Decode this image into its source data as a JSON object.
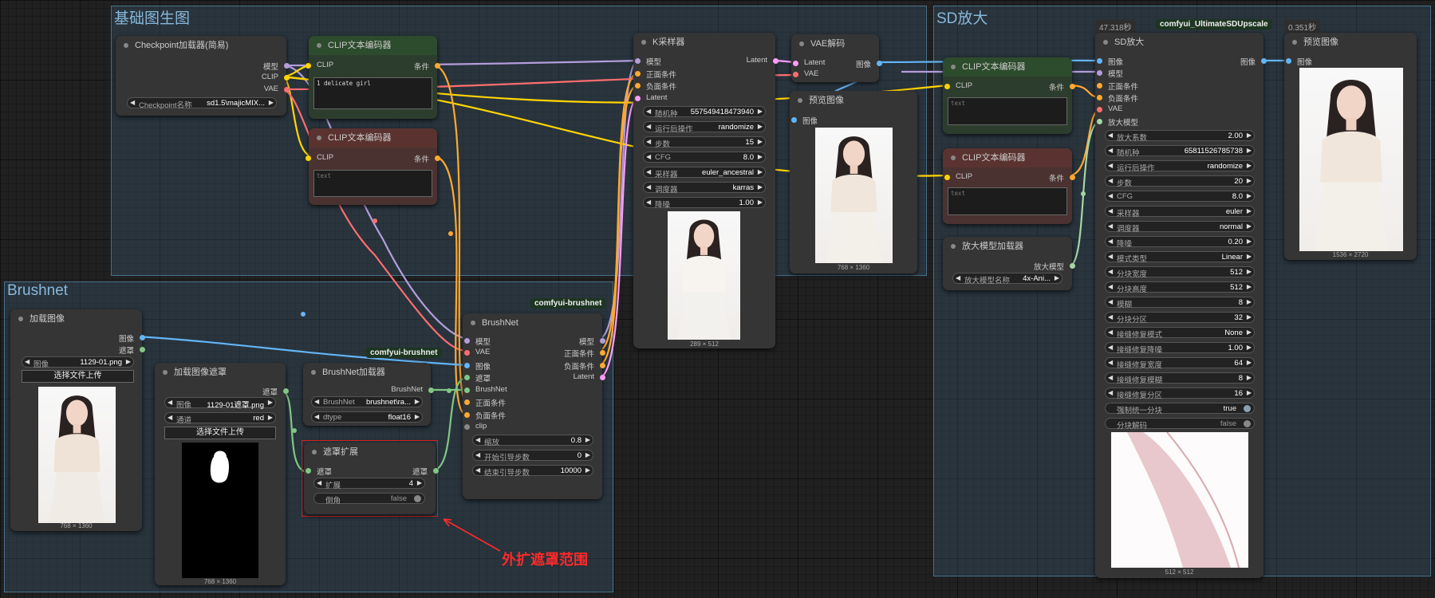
{
  "groups": {
    "base": "基础图生图",
    "brushnet": "Brushnet",
    "upscale": "SD放大"
  },
  "ckpt": {
    "title": "Checkpoint加载器(简易)",
    "out_model": "模型",
    "out_clip": "CLIP",
    "out_vae": "VAE",
    "ckpt_label": "Checkpoint名称",
    "ckpt_value": "sd1.5\\majicMIX..."
  },
  "clip_pos": {
    "title": "CLIP文本编码器",
    "in_clip": "CLIP",
    "out": "条件",
    "text": "1 delicate girl"
  },
  "clip_neg": {
    "title": "CLIP文本编码器",
    "in_clip": "CLIP",
    "out": "条件",
    "text": "text"
  },
  "ksampler": {
    "title": "K采样器",
    "in_model": "模型",
    "in_pos": "正面条件",
    "in_neg": "负面条件",
    "in_latent": "Latent",
    "out_latent": "Latent",
    "widgets": [
      {
        "label": "随机种",
        "value": "557549418473940"
      },
      {
        "label": "运行后操作",
        "value": "randomize"
      },
      {
        "label": "步数",
        "value": "15"
      },
      {
        "label": "CFG",
        "value": "8.0"
      },
      {
        "label": "采样器",
        "value": "euler_ancestral"
      },
      {
        "label": "调度器",
        "value": "karras"
      },
      {
        "label": "降噪",
        "value": "1.00"
      }
    ],
    "size": "289 × 512"
  },
  "vae_decode": {
    "title": "VAE解码",
    "in_latent": "Latent",
    "in_vae": "VAE",
    "out_image": "图像"
  },
  "preview1": {
    "title": "预览图像",
    "in_image": "图像",
    "size": "768 × 1360"
  },
  "load_image": {
    "title": "加载图像",
    "out_image": "图像",
    "out_mask": "遮罩",
    "img_label": "图像",
    "img_value": "1129-01.png",
    "upload": "选择文件上传",
    "size": "768 × 1360"
  },
  "load_mask": {
    "title": "加载图像遮罩",
    "out_mask": "遮罩",
    "img_label": "图像",
    "img_value": "1129-01遮罩.png",
    "ch_label": "通道",
    "ch_value": "red",
    "upload": "选择文件上传",
    "size": "768 × 1360"
  },
  "bn_loader": {
    "title": "BrushNet加载器",
    "badge": "comfyui-brushnet",
    "out": "BrushNet",
    "bn_label": "BrushNet",
    "bn_value": "brushnet\\ra...",
    "dt_label": "dtype",
    "dt_value": "float16"
  },
  "mask_expand": {
    "title": "遮罩扩展",
    "in_mask": "遮罩",
    "out_mask": "遮罩",
    "exp_label": "扩展",
    "exp_value": "4",
    "tap_label": "倒角",
    "tap_value": "false"
  },
  "brushnet": {
    "title": "BrushNet",
    "badge": "comfyui-brushnet",
    "in_model": "模型",
    "in_vae": "VAE",
    "in_image": "图像",
    "in_mask": "遮罩",
    "in_bn": "BrushNet",
    "in_pos": "正面条件",
    "in_neg": "负面条件",
    "in_clip": "clip",
    "out_model": "模型",
    "out_pos": "正面条件",
    "out_neg": "负面条件",
    "out_latent": "Latent",
    "w_scale_label": "缩放",
    "w_scale_value": "0.8",
    "w_start_label": "开始引导步数",
    "w_start_value": "0",
    "w_end_label": "结束引导步数",
    "w_end_value": "10000"
  },
  "annotation": "外扩遮罩范围",
  "up_clip_pos": {
    "title": "CLIP文本编码器",
    "in_clip": "CLIP",
    "out": "条件",
    "text": "text"
  },
  "up_clip_neg": {
    "title": "CLIP文本编码器",
    "in_clip": "CLIP",
    "out": "条件",
    "text": "text"
  },
  "up_model_loader": {
    "title": "放大模型加载器",
    "out": "放大模型",
    "label": "放大模型名称",
    "value": "4x-Ani..."
  },
  "sd_upscale": {
    "title": "SD放大",
    "badge": "comfyui_UltimateSDUpscale",
    "time": "47.318秒",
    "in_image": "图像",
    "in_model": "模型",
    "in_pos": "正面条件",
    "in_neg": "负面条件",
    "in_vae": "VAE",
    "in_up": "放大模型",
    "out_image": "图像",
    "widgets": [
      {
        "label": "放大系数",
        "value": "2.00"
      },
      {
        "label": "随机种",
        "value": "65811526785738"
      },
      {
        "label": "运行后操作",
        "value": "randomize"
      },
      {
        "label": "步数",
        "value": "20"
      },
      {
        "label": "CFG",
        "value": "8.0"
      },
      {
        "label": "采样器",
        "value": "euler"
      },
      {
        "label": "调度器",
        "value": "normal"
      },
      {
        "label": "降噪",
        "value": "0.20"
      },
      {
        "label": "模式类型",
        "value": "Linear"
      },
      {
        "label": "分块宽度",
        "value": "512"
      },
      {
        "label": "分块高度",
        "value": "512"
      },
      {
        "label": "模糊",
        "value": "8"
      },
      {
        "label": "分块分区",
        "value": "32"
      },
      {
        "label": "接缝修复模式",
        "value": "None"
      },
      {
        "label": "接缝修复降噪",
        "value": "1.00"
      },
      {
        "label": "接缝修复宽度",
        "value": "64"
      },
      {
        "label": "接缝修复模糊",
        "value": "8"
      },
      {
        "label": "接缝修复分区",
        "value": "16"
      }
    ],
    "t1_label": "强制统一分块",
    "t1_value": "true",
    "t2_label": "分块解码",
    "t2_value": "false",
    "size": "512 × 512"
  },
  "preview2": {
    "title": "预览图像",
    "in_image": "图像",
    "time": "0.351秒",
    "size": "1536 × 2720"
  },
  "colors": {
    "model": "#b39ddb",
    "clip": "#ffd500",
    "vae": "#ff6e6e",
    "cond": "#ffa931",
    "latent": "#ff9cf9",
    "image": "#64b5f6",
    "mask": "#81c784",
    "upmodel": "#a5d6a7",
    "annotation": "#ff2a2a"
  }
}
